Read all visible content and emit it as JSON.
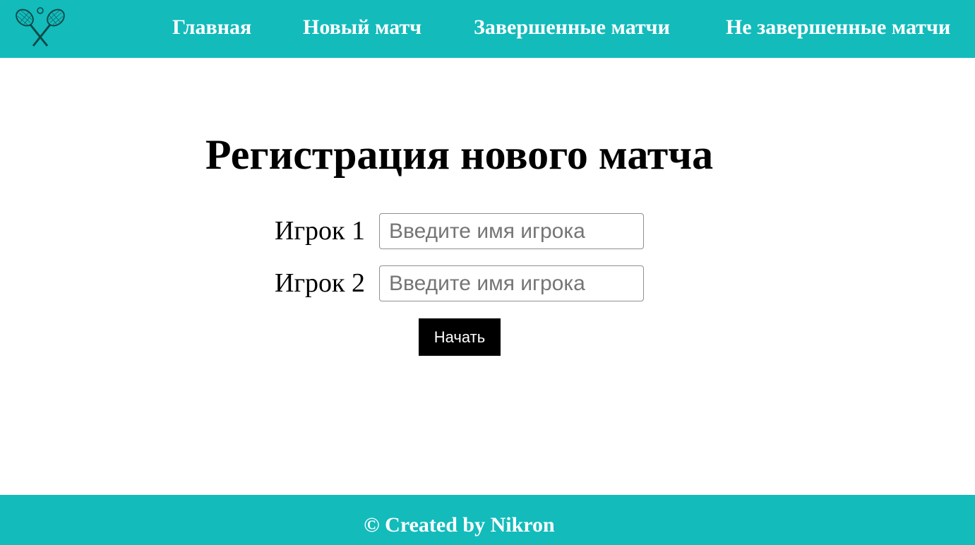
{
  "header": {
    "logo_icon": "crossed-tennis-rackets-icon",
    "nav": [
      {
        "label": "Главная"
      },
      {
        "label": "Новый матч"
      },
      {
        "label": "Завершенные матчи"
      },
      {
        "label": "Не завершенные матчи"
      }
    ]
  },
  "main": {
    "title": "Регистрация нового матча",
    "players": [
      {
        "label": "Игрок 1",
        "placeholder": "Введите имя игрока",
        "value": ""
      },
      {
        "label": "Игрок 2",
        "placeholder": "Введите имя игрока",
        "value": ""
      }
    ],
    "start_label": "Начать"
  },
  "footer": {
    "text": "© Created by Nikron"
  },
  "colors": {
    "accent": "#13bbbb",
    "button_bg": "#000000",
    "text_light": "#ffffff"
  }
}
